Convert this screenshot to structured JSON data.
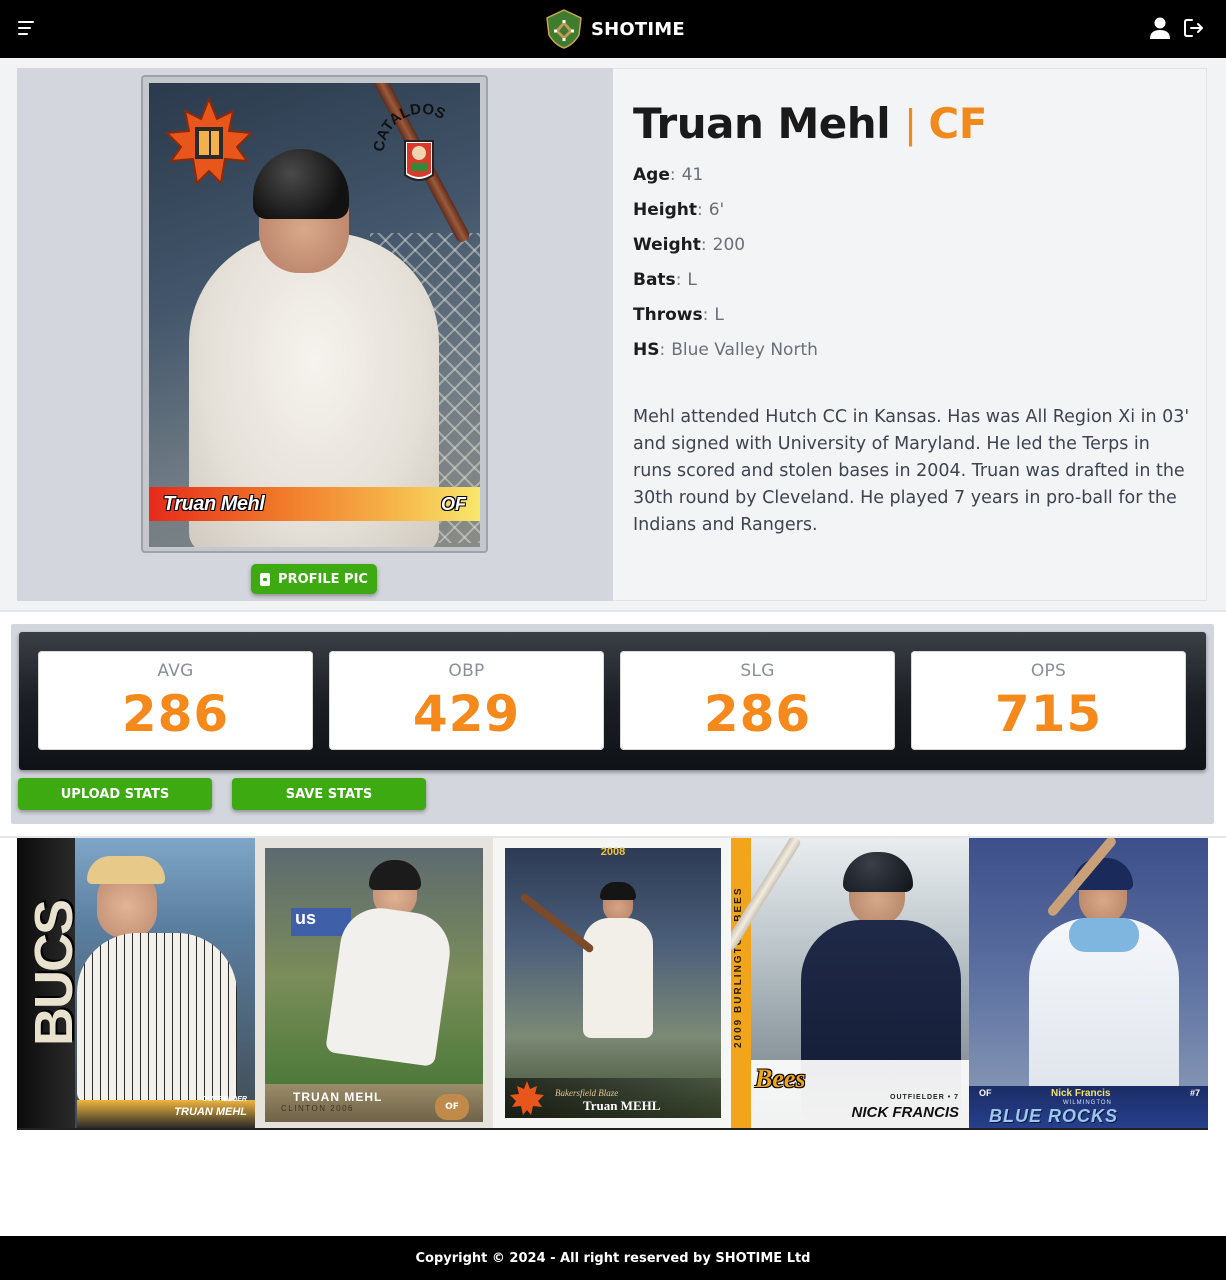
{
  "app": {
    "brand": "SHOTIME"
  },
  "player": {
    "name": "Truan Mehl",
    "separator": "|",
    "position": "CF",
    "attributes": [
      {
        "key": "Age",
        "value": "41"
      },
      {
        "key": "Height",
        "value": "6'"
      },
      {
        "key": "Weight",
        "value": "200"
      },
      {
        "key": "Bats",
        "value": "L"
      },
      {
        "key": "Throws",
        "value": "L"
      },
      {
        "key": "HS",
        "value": "Blue Valley North"
      }
    ],
    "bio": "Mehl attended Hutch CC in Kansas. Has was All Region Xi in 03' and signed with University of Maryland. He led the Terps in runs scored and stolen bases in 2004. Truan was drafted in the 30th round by Cleveland. He played 7 years in pro-ball for the Indians and Rangers."
  },
  "profile_card": {
    "name": "Truan Mehl",
    "position": "OF",
    "team_logo_text": "CATALDOS"
  },
  "profile_pic_button": "PROFILE PIC",
  "stats": [
    {
      "label": "AVG",
      "value": "286"
    },
    {
      "label": "OBP",
      "value": "429"
    },
    {
      "label": "SLG",
      "value": "286"
    },
    {
      "label": "OPS",
      "value": "715"
    }
  ],
  "buttons": {
    "upload": "UPLOAD STATS",
    "save": "SAVE STATS"
  },
  "gallery": [
    {
      "team": "BUCS",
      "role": "OUTFIELDER",
      "name": "TRUAN MEHL"
    },
    {
      "name": "TRUAN MEHL",
      "sub": "CLINTON 2006",
      "position": "OF"
    },
    {
      "year": "2008",
      "team": "Bakersfield Blaze",
      "name": "Truan MEHL"
    },
    {
      "vertical": "2009 BURLINGTON BEES",
      "logo": "Bees",
      "role": "OUTFIELDER • 7",
      "name": "NICK FRANCIS"
    },
    {
      "position": "OF",
      "name": "Nick Francis",
      "city": "WILMINGTON",
      "team": "BLUE ROCKS",
      "number": "#7"
    }
  ],
  "footer": {
    "copyright": "Copyright © 2024 - All right reserved by SHOTIME Ltd"
  }
}
